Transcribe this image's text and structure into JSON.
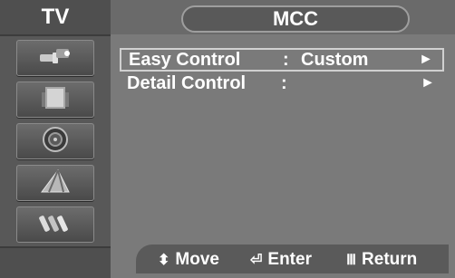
{
  "sidebar": {
    "title": "TV",
    "items": [
      {
        "icon": "cable-input-icon"
      },
      {
        "icon": "speaker-picture-icon"
      },
      {
        "icon": "sound-speaker-icon"
      },
      {
        "icon": "antenna-icon"
      },
      {
        "icon": "plugs-setup-icon"
      }
    ]
  },
  "header": {
    "title": "MCC"
  },
  "menu": [
    {
      "label": "Easy Control",
      "colon": ":",
      "value": "Custom",
      "arrow": "►"
    },
    {
      "label": "Detail Control",
      "colon": ":",
      "value": "",
      "arrow": "►"
    }
  ],
  "footer": {
    "move_icon": "⬍",
    "move_label": "Move",
    "enter_icon": "⏎",
    "enter_label": "Enter",
    "return_icon": "Ⅲ",
    "return_label": "Return"
  }
}
